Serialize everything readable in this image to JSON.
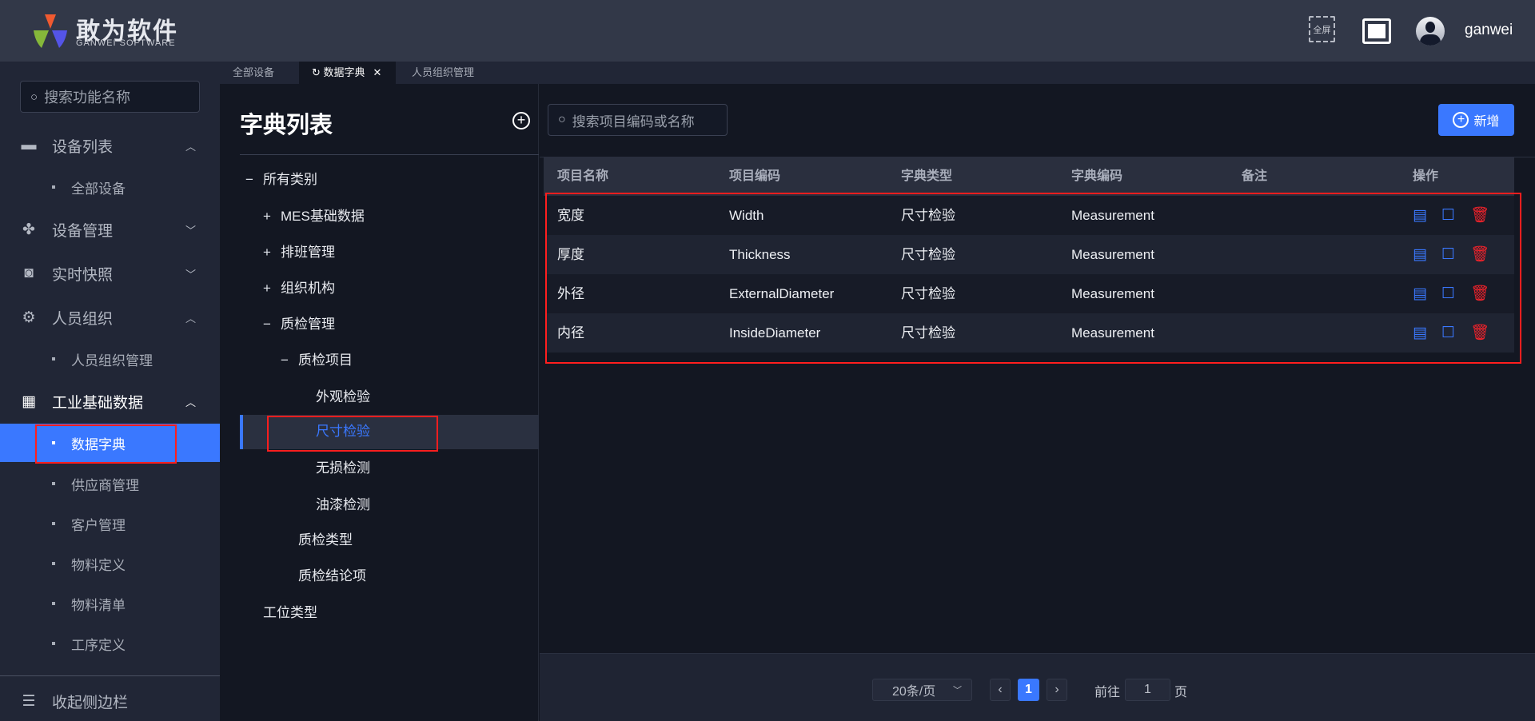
{
  "header": {
    "logo_text": "敢为软件",
    "logo_sub": "GANWEI SOFTWARE",
    "fullscreen_label": "全屏",
    "username": "ganwei"
  },
  "tabs": [
    {
      "label": "全部设备"
    },
    {
      "label": "数据字典"
    },
    {
      "label": "人员组织管理"
    }
  ],
  "sidebar": {
    "search_placeholder": "搜索功能名称",
    "menus": [
      {
        "label": "设备列表",
        "icon": "monitor-icon",
        "expanded": true
      },
      {
        "label": "全部设备"
      },
      {
        "label": "设备管理",
        "icon": "grid-clover-icon",
        "expanded": false
      },
      {
        "label": "实时快照",
        "icon": "camera-icon",
        "expanded": false
      },
      {
        "label": "人员组织",
        "icon": "gear-icon",
        "expanded": true
      },
      {
        "label": "人员组织管理"
      },
      {
        "label": "工业基础数据",
        "icon": "apps-icon",
        "expanded": true
      },
      {
        "label": "数据字典",
        "active": true
      },
      {
        "label": "供应商管理"
      },
      {
        "label": "客户管理"
      },
      {
        "label": "物料定义"
      },
      {
        "label": "物料清单"
      },
      {
        "label": "工序定义"
      }
    ],
    "collapse_label": "收起侧边栏"
  },
  "tree": {
    "title": "字典列表",
    "nodes": [
      {
        "label": "所有类别",
        "toggle": "−"
      },
      {
        "label": "MES基础数据",
        "toggle": "+"
      },
      {
        "label": "排班管理",
        "toggle": "+"
      },
      {
        "label": "组织机构",
        "toggle": "+"
      },
      {
        "label": "质检管理",
        "toggle": "−"
      },
      {
        "label": "质检项目",
        "toggle": "−"
      },
      {
        "label": "外观检验"
      },
      {
        "label": "尺寸检验",
        "selected": true
      },
      {
        "label": "无损检测"
      },
      {
        "label": "油漆检测"
      },
      {
        "label": "质检类型"
      },
      {
        "label": "质检结论项"
      },
      {
        "label": "工位类型"
      }
    ]
  },
  "main": {
    "search_placeholder": "搜索项目编码或名称",
    "add_label": "新增",
    "columns": [
      "项目名称",
      "项目编码",
      "字典类型",
      "字典编码",
      "备注",
      "操作"
    ],
    "rows": [
      [
        "宽度",
        "Width",
        "尺寸检验",
        "Measurement",
        ""
      ],
      [
        "厚度",
        "Thickness",
        "尺寸检验",
        "Measurement",
        ""
      ],
      [
        "外径",
        "ExternalDiameter",
        "尺寸检验",
        "Measurement",
        ""
      ],
      [
        "内径",
        "InsideDiameter",
        "尺寸检验",
        "Measurement",
        ""
      ]
    ],
    "actions": [
      "view-icon",
      "edit-icon",
      "delete-icon"
    ]
  },
  "pagination": {
    "page_size": "20条/页",
    "current_page": "1",
    "goto_label": "前往",
    "goto_value": "1",
    "page_unit": "页"
  },
  "colors": {
    "accent": "#3a78ff",
    "danger": "#f0222a",
    "annotation": "#ff1e1e"
  }
}
